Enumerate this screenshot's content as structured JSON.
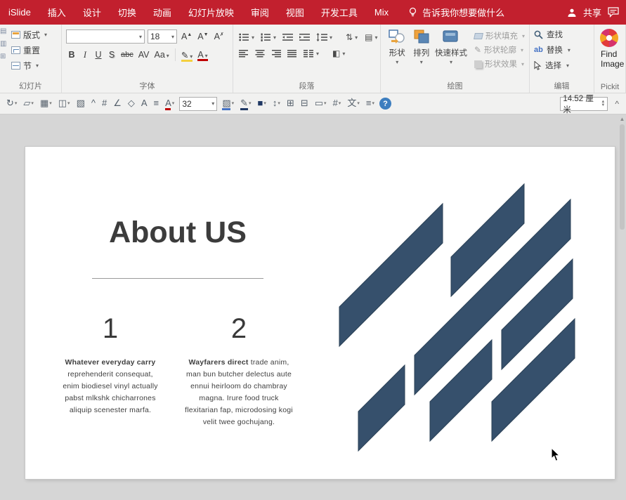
{
  "colors": {
    "menubar_bg": "#C2202E",
    "canvas_bg": "#D6D6D6"
  },
  "menubar": {
    "tabs": [
      "iSlide",
      "插入",
      "设计",
      "切换",
      "动画",
      "幻灯片放映",
      "审阅",
      "视图",
      "开发工具",
      "Mix"
    ],
    "search_label": "告诉我你想要做什么",
    "share_label": "共享"
  },
  "ribbon": {
    "slides_group": {
      "label": "幻灯片",
      "layout_button": "版式",
      "reset_button": "重置",
      "section_button": "节"
    },
    "font_group": {
      "label": "字体",
      "font_name_value": "",
      "font_size_value": "18",
      "bold": "B",
      "italic": "I",
      "underline": "U",
      "shadow": "S",
      "strikethrough": "abc",
      "char_spacing": "AV",
      "change_case": "Aa",
      "grow_font": "A",
      "shrink_font": "A",
      "clear_format": "A"
    },
    "paragraph_group": {
      "label": "段落"
    },
    "drawing_group": {
      "label": "绘图",
      "shapes_button": "形状",
      "arrange_button": "排列",
      "quick_styles_button": "快速样式",
      "shape_fill_button": "形状填充",
      "shape_outline_button": "形状轮廓",
      "shape_effects_button": "形状效果"
    },
    "editing_group": {
      "label": "编辑",
      "find_button": "查找",
      "replace_button": "替换",
      "select_button": "选择",
      "replace_icon_text": "ab"
    },
    "pickit_group": {
      "label": "Pickit",
      "find_image_line1": "Find",
      "find_image_line2": "Image"
    }
  },
  "toolbar2": {
    "zoom_value": "32",
    "measure_value": "14.52 厘米",
    "help_glyph": "?",
    "collapse_glyph": "^",
    "icons_left": [
      {
        "name": "rotate-shape-icon",
        "glyph": "↻",
        "dd": true
      },
      {
        "name": "edit-shape-icon",
        "glyph": "▱",
        "dd": true
      },
      {
        "name": "grid-guides-icon",
        "glyph": "▦",
        "dd": true
      },
      {
        "name": "arrange-align-icon",
        "glyph": "◫",
        "dd": true
      },
      {
        "name": "format-painter-icon",
        "glyph": "▧",
        "dd": false
      },
      {
        "name": "insert-caret-icon",
        "glyph": "^",
        "dd": false
      },
      {
        "name": "insert-hash-icon",
        "glyph": "#",
        "dd": false
      },
      {
        "name": "draw-angle-icon",
        "glyph": "∠",
        "dd": false
      },
      {
        "name": "shape-3d-icon",
        "glyph": "◇",
        "dd": false
      },
      {
        "name": "text-box-icon",
        "glyph": "A",
        "dd": false
      },
      {
        "name": "align-paragraph-icon",
        "glyph": "≡",
        "dd": false
      },
      {
        "name": "font-color-icon",
        "glyph": "A",
        "dd": true,
        "bar": "#c00000"
      }
    ],
    "icons_mid": [
      {
        "name": "fill-color-icon",
        "glyph": "▨",
        "dd": true,
        "bar": "#4472c4"
      },
      {
        "name": "line-color-icon",
        "glyph": "✎",
        "dd": true,
        "bar": "#1f3864"
      },
      {
        "name": "theme-color-icon",
        "glyph": "■",
        "dd": true,
        "color": "#1f3864"
      },
      {
        "name": "row-spacing-icon",
        "glyph": "↕",
        "dd": true
      },
      {
        "name": "duplicate-object-icon",
        "glyph": "⊞",
        "dd": false
      },
      {
        "name": "copy-style-icon",
        "glyph": "⊟",
        "dd": false
      },
      {
        "name": "insert-rectangle-icon",
        "glyph": "▭",
        "dd": true
      },
      {
        "name": "numbering-format-icon",
        "glyph": "#",
        "dd": true
      },
      {
        "name": "text-style-icon",
        "glyph": "文",
        "dd": true
      },
      {
        "name": "more-options-icon",
        "glyph": "≡",
        "dd": true
      }
    ]
  },
  "slide": {
    "title": "About US",
    "emblem_color": "#36506C",
    "emblem_stroke": "#2B4156",
    "columns": [
      {
        "number": "1",
        "lead": "Whatever everyday carry",
        "body": " reprehenderit consequat, enim biodiesel vinyl actually pabst mlkshk chicharrones aliquip scenester marfa."
      },
      {
        "number": "2",
        "lead": "Wayfarers direct",
        "body": " trade anim, man bun butcher delectus aute ennui heirloom do chambray magna. Irure food truck flexitarian fap, microdosing kogi velit twee gochujang."
      }
    ]
  }
}
